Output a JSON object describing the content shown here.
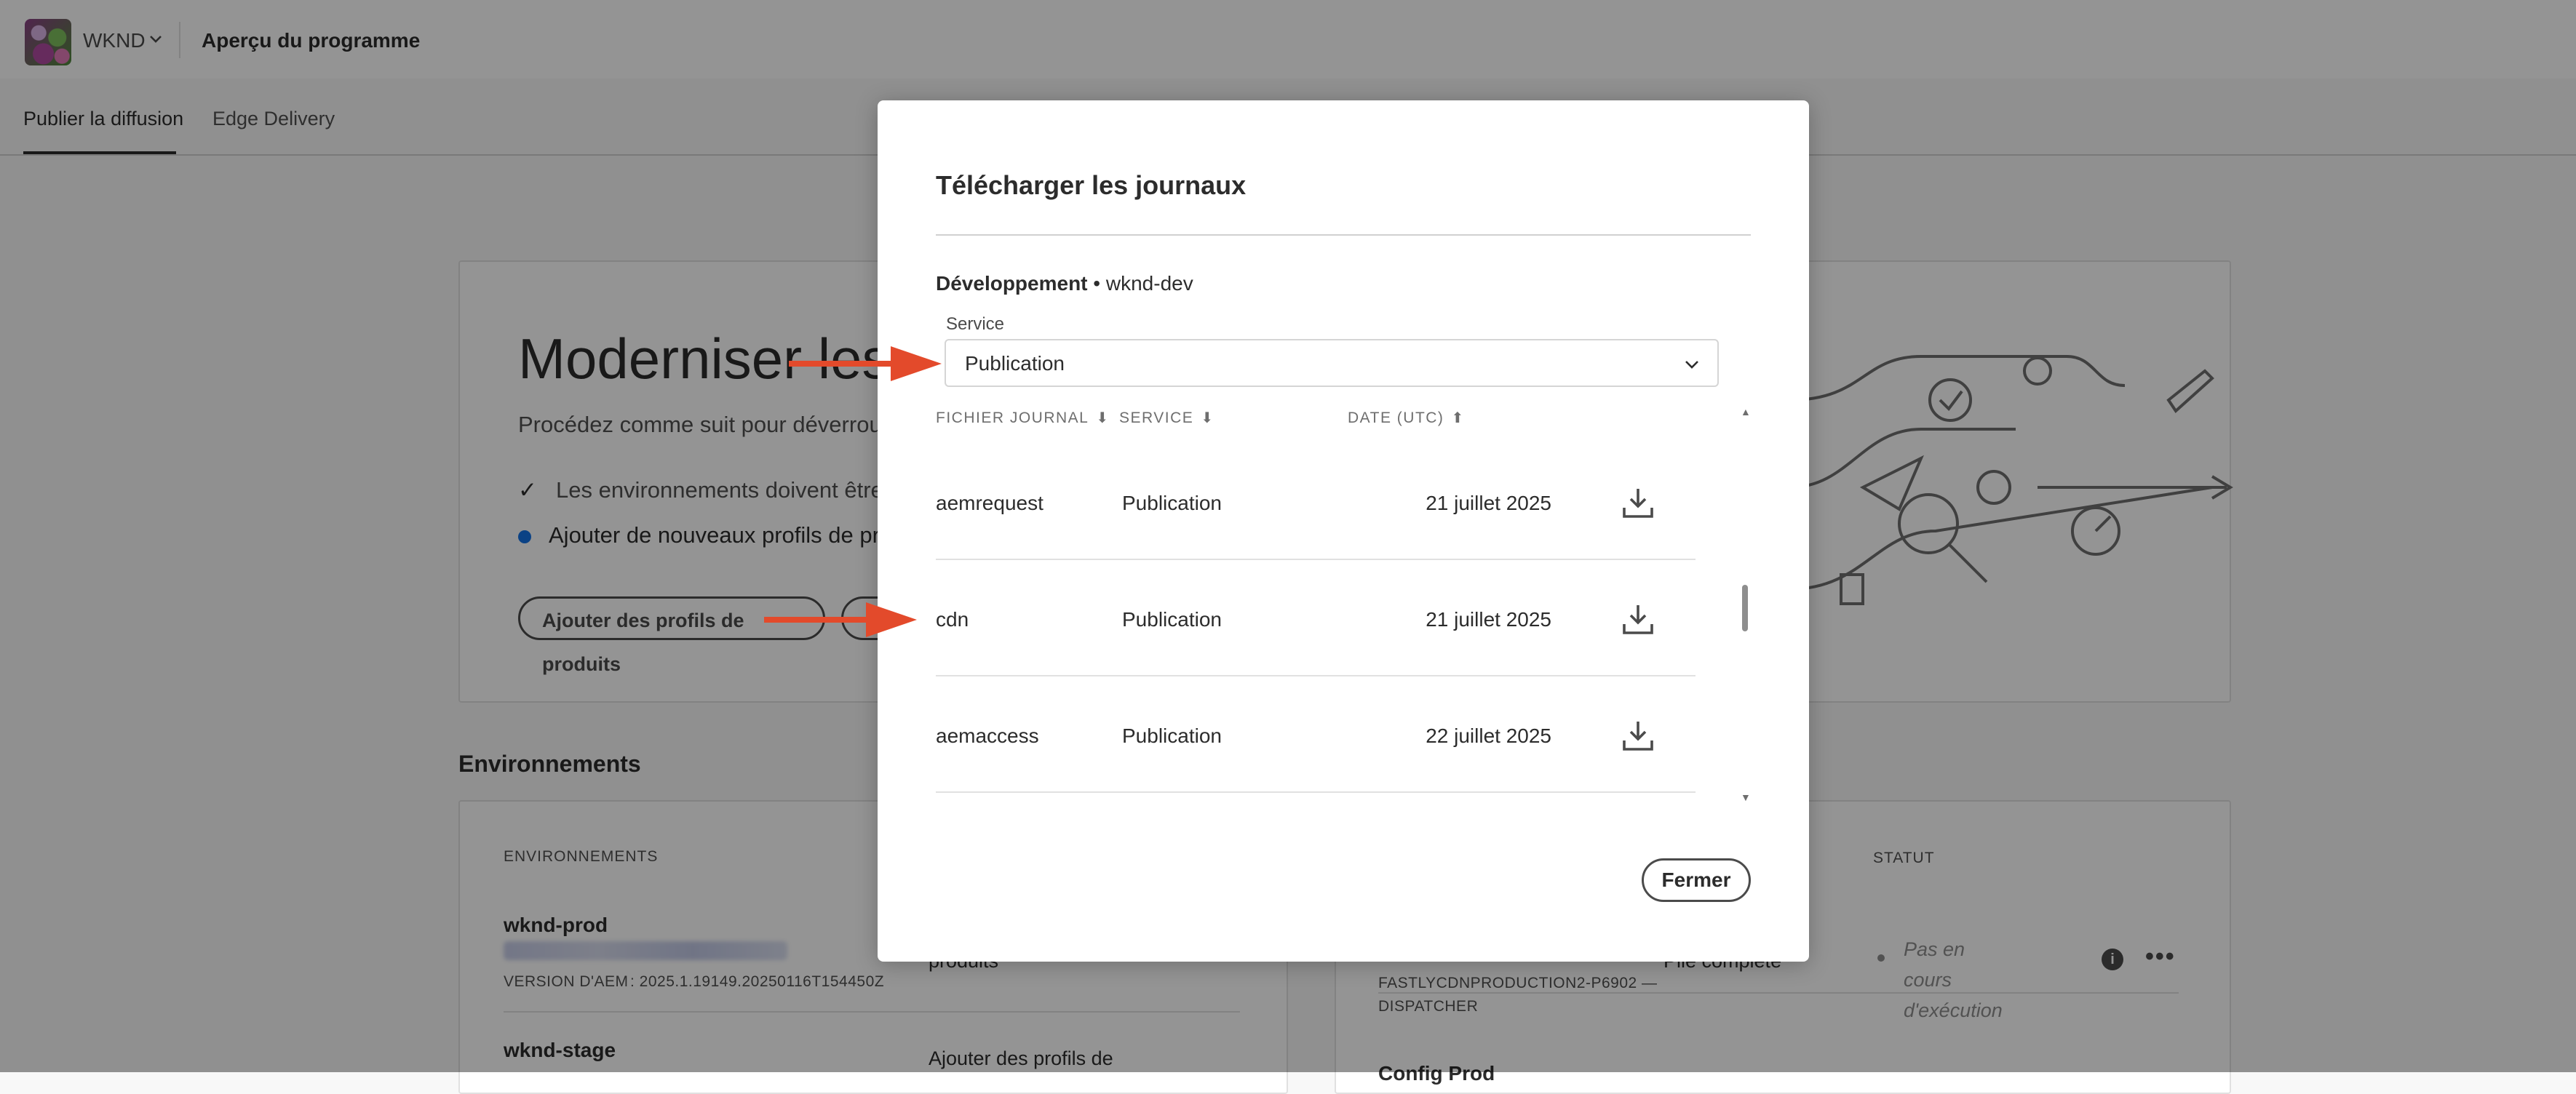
{
  "topbar": {
    "org_name": "WKND",
    "program_title": "Aperçu du programme"
  },
  "tabs": [
    {
      "label": "Publier la diffusion",
      "active": true
    },
    {
      "label": "Edge Delivery",
      "active": false
    }
  ],
  "hero": {
    "title": "Moderniser les e",
    "subtitle": "Procédez comme suit pour déverrouill",
    "check_item": "Les environnements doivent être n",
    "dot_item": "Ajouter de nouveaux profils de pro",
    "add_profiles_button": "Ajouter des profils de produits",
    "second_button": "E"
  },
  "environments": {
    "section_title": "Environnements",
    "col_environments": "ENVIRONNEMENTS",
    "col_status": "STATUT",
    "rows": [
      {
        "name": "wknd-prod",
        "version_label": "VERSION D'AEM",
        "version": ": 2025.1.19149.20250116T154450Z",
        "profiles_text": "produits"
      },
      {
        "name": "wknd-stage",
        "profiles_text": "Ajouter des profils de"
      }
    ],
    "pipeline": {
      "name_line1": "FASTLYCDNPRODUCTION2-P6902 —",
      "name_line2": "DISPATCHER",
      "pipeline_type": "Pile complète",
      "status": "Pas en cours d'exécution",
      "next_name": "Config Prod"
    }
  },
  "modal": {
    "title": "Télécharger les journaux",
    "env_label": "Développement",
    "env_separator": " • ",
    "env_name": "wknd-dev",
    "service_label": "Service",
    "service_value": "Publication",
    "columns": {
      "file": "FICHIER JOURNAL",
      "service": "SERVICE",
      "date": "DATE (UTC)"
    },
    "rows": [
      {
        "file": "aemrequest",
        "service": "Publication",
        "date": "21 juillet 2025"
      },
      {
        "file": "cdn",
        "service": "Publication",
        "date": "21 juillet 2025"
      },
      {
        "file": "aemaccess",
        "service": "Publication",
        "date": "22 juillet 2025"
      }
    ],
    "close_label": "Fermer"
  },
  "colors": {
    "accent_arrow": "#e34a2b",
    "blue_dot": "#1473e6",
    "overlay": "rgba(0,0,0,0.42)"
  }
}
